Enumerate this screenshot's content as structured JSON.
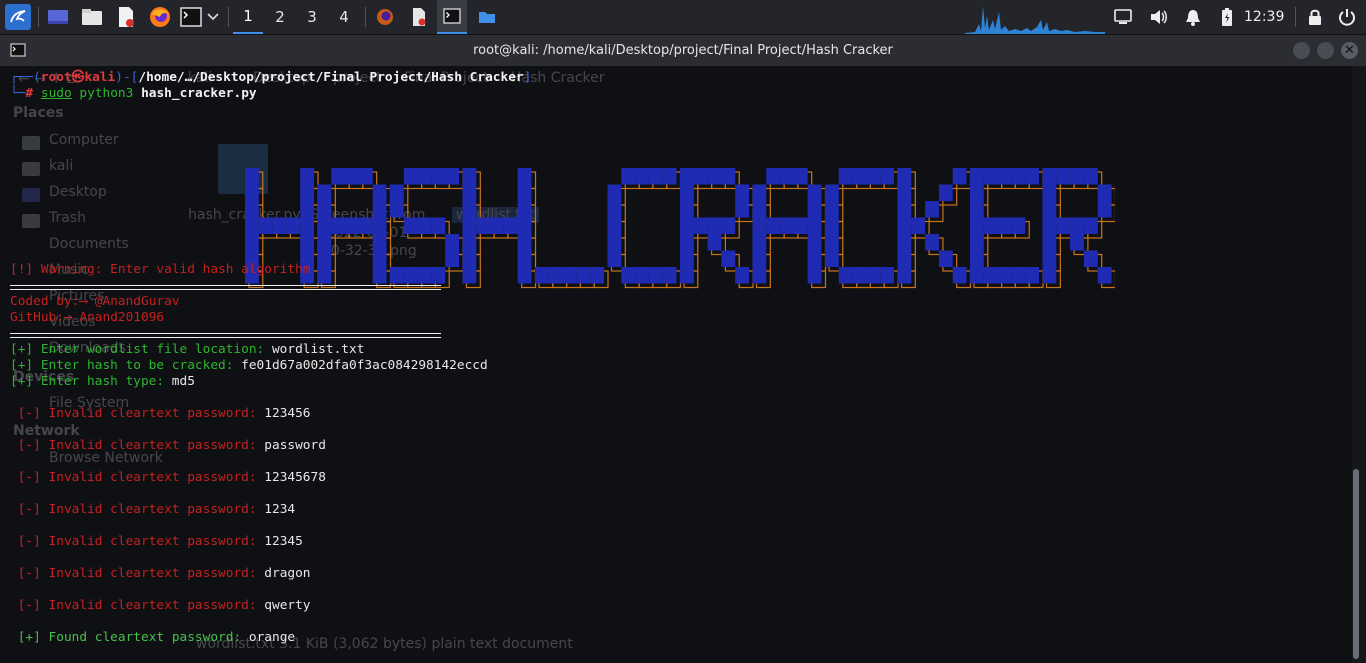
{
  "panel": {
    "workspaces": [
      "1",
      "2",
      "3",
      "4"
    ],
    "active_workspace": 0,
    "clock": "12:39"
  },
  "window": {
    "title": "root@kali: /home/kali/Desktop/project/Final Project/Hash Cracker"
  },
  "background_file_manager": {
    "path": [
      "kali",
      "Desktop",
      "project",
      "Final Project",
      "Hash Cracker"
    ],
    "places_header": "Places",
    "places": [
      "Computer",
      "kali",
      "Desktop",
      "Trash",
      "Documents",
      "Music",
      "Pictures",
      "Videos",
      "Downloads"
    ],
    "devices_header": "Devices",
    "devices": [
      "File System"
    ],
    "network_header": "Network",
    "network": [
      "Browse Network"
    ],
    "files": [
      "hash_cracker.py",
      "Screenshot from",
      "2022-09-01",
      "10-32-37.png",
      "wordlist.txt"
    ],
    "status": "wordlist.txt  3.1 KiB (3,062 bytes) plain text document"
  },
  "terminal": {
    "prompt_user": "root㉿kali",
    "prompt_path": "/home/…/Desktop/project/Final Project/Hash Cracker",
    "prompt_hash": "#",
    "cmd_sudo": "sudo",
    "cmd_python": "python3",
    "cmd_file": "hash_cracker.py",
    "banner": "HASH_CRACKER",
    "warning": "[!] Warning: Enter valid hash algorithm",
    "coded_by_label": "Coded by:",
    "coded_by_arrow": "⟶",
    "coded_by_value": "@AnandGurav",
    "github_label": "GitHub:",
    "github_arrow": "⟶",
    "github_value": "Anand201096",
    "input_lines": [
      {
        "label": "[+] Enter wordlist file location: ",
        "value": "wordlist.txt"
      },
      {
        "label": "[+] Enter hash to be cracked: ",
        "value": "fe01d67a002dfa0f3ac084298142eccd"
      },
      {
        "label": "[+] Enter hash type: ",
        "value": "md5"
      }
    ],
    "invalid_prefix": "[-]",
    "invalid_text": " Invalid cleartext password: ",
    "attempts": [
      "123456",
      "password",
      "12345678",
      "1234",
      "12345",
      "dragon",
      "qwerty"
    ],
    "found_prefix": "[+]",
    "found_text": " Found cleartext password: ",
    "found_value": "orange"
  },
  "colors": {
    "banner_fill": "#1f2bb3",
    "banner_outline": "#c8741d",
    "error": "#c4211f",
    "success": "#2fb52f",
    "accent": "#3f8fe6"
  }
}
